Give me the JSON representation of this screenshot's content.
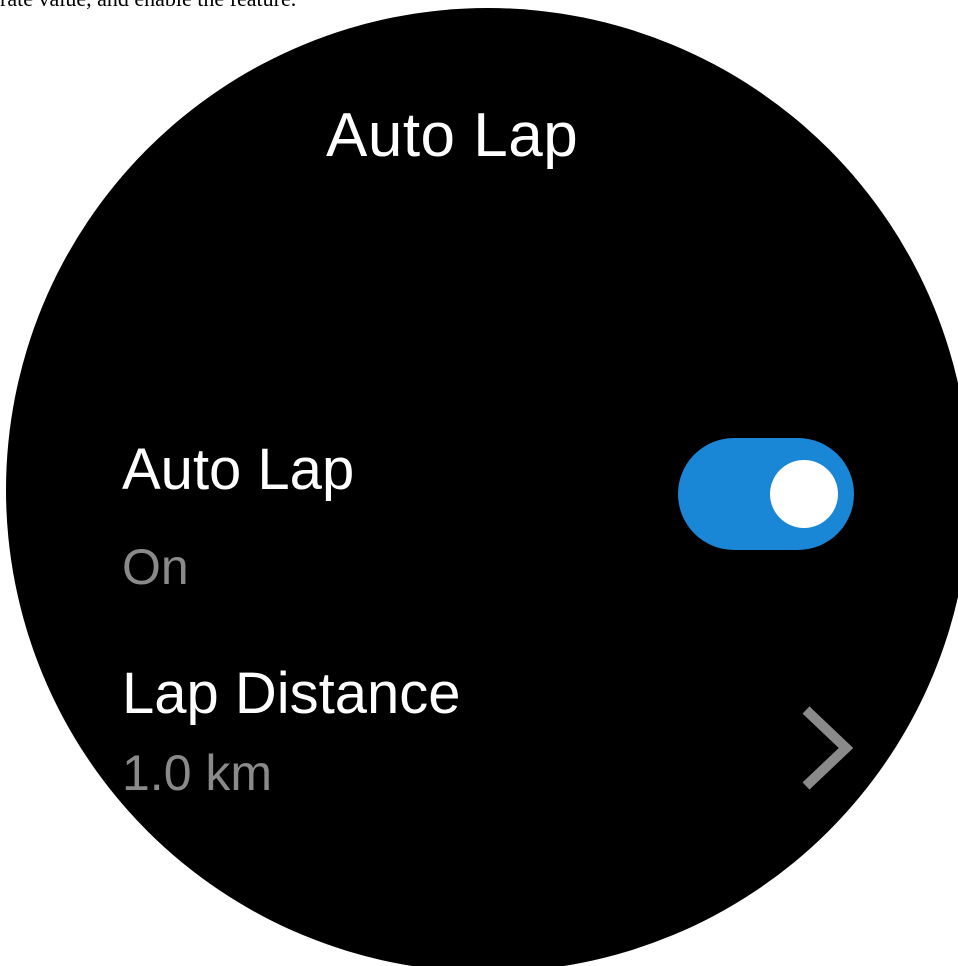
{
  "caption_fragment": "rate value, and enable the feature.",
  "title": "Auto Lap",
  "settings": [
    {
      "label": "Auto Lap",
      "value": "On",
      "control": "toggle",
      "toggle_on": true,
      "toggle_color": "#1a86d6"
    },
    {
      "label": "Lap Distance",
      "value": "1.0 km",
      "control": "chevron",
      "icon": "chevron-right-icon"
    }
  ],
  "colors": {
    "background": "#000000",
    "primary_text": "#ffffff",
    "secondary_text": "#8a8a8a",
    "accent": "#1a86d6"
  }
}
